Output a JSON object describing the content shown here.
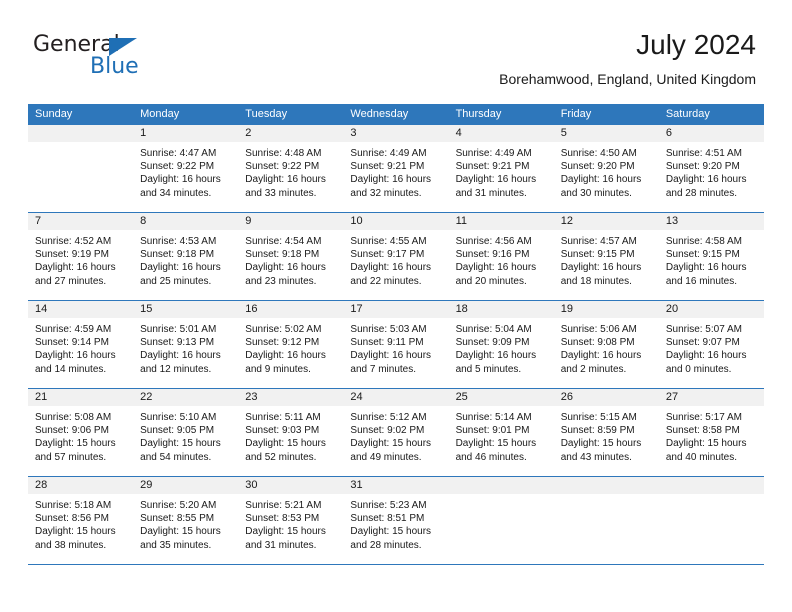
{
  "brand": {
    "name_part1": "General",
    "name_part2": "Blue",
    "triangle_icon": "blue-triangle-icon",
    "accent_color": "#1f6fb5"
  },
  "header": {
    "month_title": "July 2024",
    "location": "Borehamwood, England, United Kingdom"
  },
  "theme": {
    "header_blue": "#2e77bb",
    "day_band_gray": "#f1f1f1",
    "text_color": "#1a1a1a"
  },
  "weekdays": [
    "Sunday",
    "Monday",
    "Tuesday",
    "Wednesday",
    "Thursday",
    "Friday",
    "Saturday"
  ],
  "weeks": [
    [
      {
        "day": "",
        "empty": true,
        "sunrise": "",
        "sunset": "",
        "daylight_line1": "",
        "daylight_line2": ""
      },
      {
        "day": "1",
        "sunrise": "Sunrise: 4:47 AM",
        "sunset": "Sunset: 9:22 PM",
        "daylight_line1": "Daylight: 16 hours",
        "daylight_line2": "and 34 minutes."
      },
      {
        "day": "2",
        "sunrise": "Sunrise: 4:48 AM",
        "sunset": "Sunset: 9:22 PM",
        "daylight_line1": "Daylight: 16 hours",
        "daylight_line2": "and 33 minutes."
      },
      {
        "day": "3",
        "sunrise": "Sunrise: 4:49 AM",
        "sunset": "Sunset: 9:21 PM",
        "daylight_line1": "Daylight: 16 hours",
        "daylight_line2": "and 32 minutes."
      },
      {
        "day": "4",
        "sunrise": "Sunrise: 4:49 AM",
        "sunset": "Sunset: 9:21 PM",
        "daylight_line1": "Daylight: 16 hours",
        "daylight_line2": "and 31 minutes."
      },
      {
        "day": "5",
        "sunrise": "Sunrise: 4:50 AM",
        "sunset": "Sunset: 9:20 PM",
        "daylight_line1": "Daylight: 16 hours",
        "daylight_line2": "and 30 minutes."
      },
      {
        "day": "6",
        "sunrise": "Sunrise: 4:51 AM",
        "sunset": "Sunset: 9:20 PM",
        "daylight_line1": "Daylight: 16 hours",
        "daylight_line2": "and 28 minutes."
      }
    ],
    [
      {
        "day": "7",
        "sunrise": "Sunrise: 4:52 AM",
        "sunset": "Sunset: 9:19 PM",
        "daylight_line1": "Daylight: 16 hours",
        "daylight_line2": "and 27 minutes."
      },
      {
        "day": "8",
        "sunrise": "Sunrise: 4:53 AM",
        "sunset": "Sunset: 9:18 PM",
        "daylight_line1": "Daylight: 16 hours",
        "daylight_line2": "and 25 minutes."
      },
      {
        "day": "9",
        "sunrise": "Sunrise: 4:54 AM",
        "sunset": "Sunset: 9:18 PM",
        "daylight_line1": "Daylight: 16 hours",
        "daylight_line2": "and 23 minutes."
      },
      {
        "day": "10",
        "sunrise": "Sunrise: 4:55 AM",
        "sunset": "Sunset: 9:17 PM",
        "daylight_line1": "Daylight: 16 hours",
        "daylight_line2": "and 22 minutes."
      },
      {
        "day": "11",
        "sunrise": "Sunrise: 4:56 AM",
        "sunset": "Sunset: 9:16 PM",
        "daylight_line1": "Daylight: 16 hours",
        "daylight_line2": "and 20 minutes."
      },
      {
        "day": "12",
        "sunrise": "Sunrise: 4:57 AM",
        "sunset": "Sunset: 9:15 PM",
        "daylight_line1": "Daylight: 16 hours",
        "daylight_line2": "and 18 minutes."
      },
      {
        "day": "13",
        "sunrise": "Sunrise: 4:58 AM",
        "sunset": "Sunset: 9:15 PM",
        "daylight_line1": "Daylight: 16 hours",
        "daylight_line2": "and 16 minutes."
      }
    ],
    [
      {
        "day": "14",
        "sunrise": "Sunrise: 4:59 AM",
        "sunset": "Sunset: 9:14 PM",
        "daylight_line1": "Daylight: 16 hours",
        "daylight_line2": "and 14 minutes."
      },
      {
        "day": "15",
        "sunrise": "Sunrise: 5:01 AM",
        "sunset": "Sunset: 9:13 PM",
        "daylight_line1": "Daylight: 16 hours",
        "daylight_line2": "and 12 minutes."
      },
      {
        "day": "16",
        "sunrise": "Sunrise: 5:02 AM",
        "sunset": "Sunset: 9:12 PM",
        "daylight_line1": "Daylight: 16 hours",
        "daylight_line2": "and 9 minutes."
      },
      {
        "day": "17",
        "sunrise": "Sunrise: 5:03 AM",
        "sunset": "Sunset: 9:11 PM",
        "daylight_line1": "Daylight: 16 hours",
        "daylight_line2": "and 7 minutes."
      },
      {
        "day": "18",
        "sunrise": "Sunrise: 5:04 AM",
        "sunset": "Sunset: 9:09 PM",
        "daylight_line1": "Daylight: 16 hours",
        "daylight_line2": "and 5 minutes."
      },
      {
        "day": "19",
        "sunrise": "Sunrise: 5:06 AM",
        "sunset": "Sunset: 9:08 PM",
        "daylight_line1": "Daylight: 16 hours",
        "daylight_line2": "and 2 minutes."
      },
      {
        "day": "20",
        "sunrise": "Sunrise: 5:07 AM",
        "sunset": "Sunset: 9:07 PM",
        "daylight_line1": "Daylight: 16 hours",
        "daylight_line2": "and 0 minutes."
      }
    ],
    [
      {
        "day": "21",
        "sunrise": "Sunrise: 5:08 AM",
        "sunset": "Sunset: 9:06 PM",
        "daylight_line1": "Daylight: 15 hours",
        "daylight_line2": "and 57 minutes."
      },
      {
        "day": "22",
        "sunrise": "Sunrise: 5:10 AM",
        "sunset": "Sunset: 9:05 PM",
        "daylight_line1": "Daylight: 15 hours",
        "daylight_line2": "and 54 minutes."
      },
      {
        "day": "23",
        "sunrise": "Sunrise: 5:11 AM",
        "sunset": "Sunset: 9:03 PM",
        "daylight_line1": "Daylight: 15 hours",
        "daylight_line2": "and 52 minutes."
      },
      {
        "day": "24",
        "sunrise": "Sunrise: 5:12 AM",
        "sunset": "Sunset: 9:02 PM",
        "daylight_line1": "Daylight: 15 hours",
        "daylight_line2": "and 49 minutes."
      },
      {
        "day": "25",
        "sunrise": "Sunrise: 5:14 AM",
        "sunset": "Sunset: 9:01 PM",
        "daylight_line1": "Daylight: 15 hours",
        "daylight_line2": "and 46 minutes."
      },
      {
        "day": "26",
        "sunrise": "Sunrise: 5:15 AM",
        "sunset": "Sunset: 8:59 PM",
        "daylight_line1": "Daylight: 15 hours",
        "daylight_line2": "and 43 minutes."
      },
      {
        "day": "27",
        "sunrise": "Sunrise: 5:17 AM",
        "sunset": "Sunset: 8:58 PM",
        "daylight_line1": "Daylight: 15 hours",
        "daylight_line2": "and 40 minutes."
      }
    ],
    [
      {
        "day": "28",
        "sunrise": "Sunrise: 5:18 AM",
        "sunset": "Sunset: 8:56 PM",
        "daylight_line1": "Daylight: 15 hours",
        "daylight_line2": "and 38 minutes."
      },
      {
        "day": "29",
        "sunrise": "Sunrise: 5:20 AM",
        "sunset": "Sunset: 8:55 PM",
        "daylight_line1": "Daylight: 15 hours",
        "daylight_line2": "and 35 minutes."
      },
      {
        "day": "30",
        "sunrise": "Sunrise: 5:21 AM",
        "sunset": "Sunset: 8:53 PM",
        "daylight_line1": "Daylight: 15 hours",
        "daylight_line2": "and 31 minutes."
      },
      {
        "day": "31",
        "sunrise": "Sunrise: 5:23 AM",
        "sunset": "Sunset: 8:51 PM",
        "daylight_line1": "Daylight: 15 hours",
        "daylight_line2": "and 28 minutes."
      },
      {
        "day": "",
        "empty": true,
        "sunrise": "",
        "sunset": "",
        "daylight_line1": "",
        "daylight_line2": ""
      },
      {
        "day": "",
        "empty": true,
        "sunrise": "",
        "sunset": "",
        "daylight_line1": "",
        "daylight_line2": ""
      },
      {
        "day": "",
        "empty": true,
        "sunrise": "",
        "sunset": "",
        "daylight_line1": "",
        "daylight_line2": ""
      }
    ]
  ]
}
